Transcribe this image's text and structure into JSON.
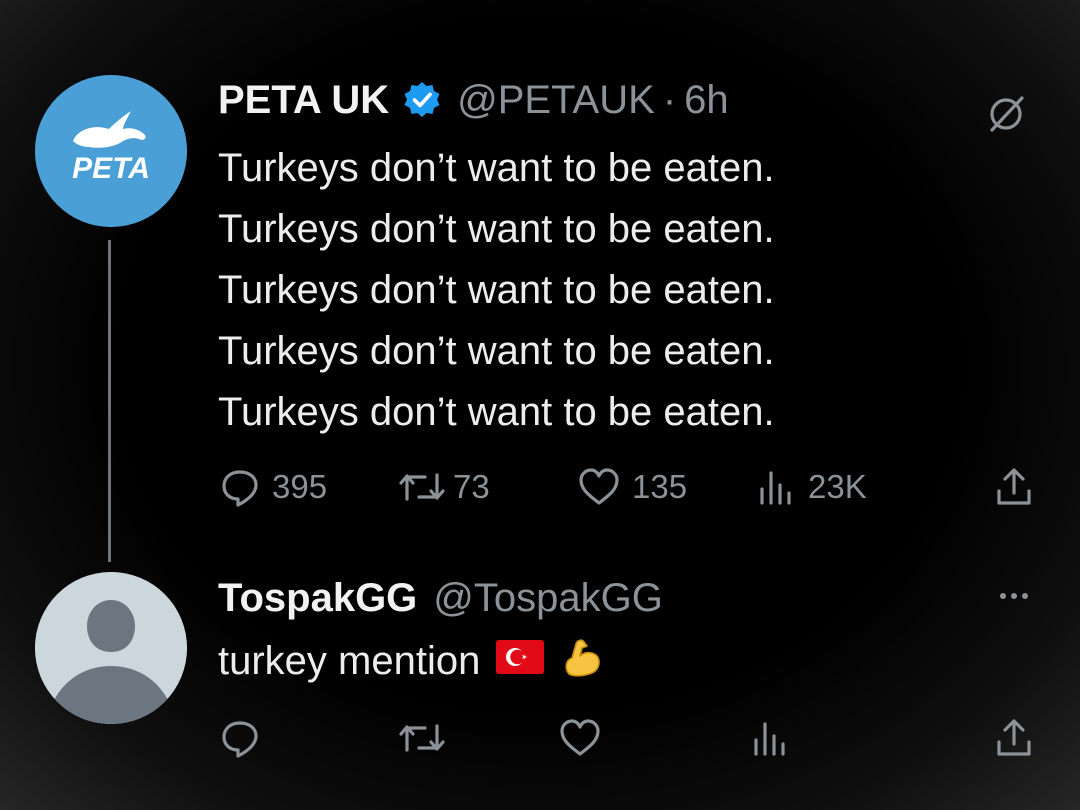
{
  "tweet": {
    "author_name": "PETA UK",
    "handle": "@PETAUK",
    "separator": "·",
    "time": "6h",
    "avatar_logo": "PETA UK",
    "lines": [
      "Turkeys don’t want to be eaten.",
      "Turkeys don’t want to be eaten.",
      "Turkeys don’t want to be eaten.",
      "Turkeys don’t want to be eaten.",
      "Turkeys don’t want to be eaten."
    ],
    "actions": {
      "replies": "395",
      "reposts": "73",
      "likes": "135",
      "views": "23K"
    },
    "top_right_icon": "grok-slash-icon"
  },
  "reply": {
    "author_name": "TospakGG",
    "handle": "@TospakGG",
    "text": "turkey mention",
    "emojis": [
      "turkey-flag-icon",
      "flexed-biceps-icon"
    ],
    "top_right_icon": "more-dots-icon"
  },
  "colors": {
    "background": "#000000",
    "text": "#e7e9ea",
    "muted": "#8b9298",
    "verified_blue": "#1d9bf0",
    "peta_blue": "#4a9fd6"
  }
}
